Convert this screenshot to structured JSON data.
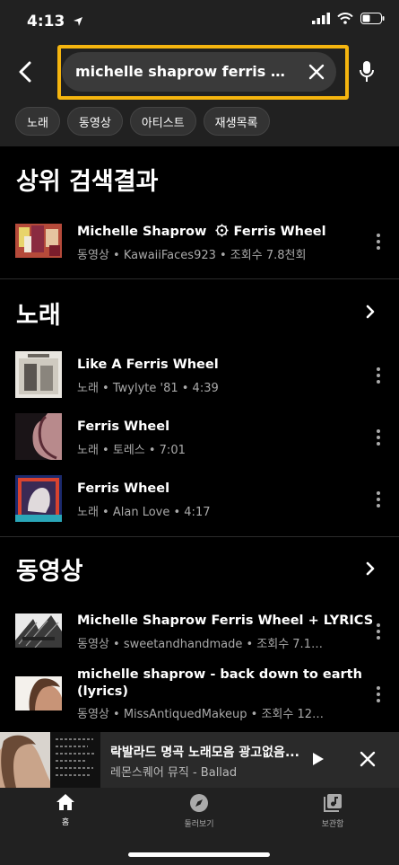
{
  "status": {
    "time": "4:13"
  },
  "search": {
    "query": "michelle shaprow ferris wheel l..."
  },
  "filters": [
    "노래",
    "동영상",
    "아티스트",
    "재생목록"
  ],
  "top_result": {
    "heading": "상위 검색결과",
    "title_part1": "Michelle Shaprow",
    "title_part2": "Ferris Wheel",
    "subtitle": "동영상 • KawaiiFaces923 • 조회수 7.8천회"
  },
  "songs": {
    "heading": "노래",
    "items": [
      {
        "title": "Like A Ferris Wheel",
        "subtitle": "노래 • Twylyte '81 • 4:39"
      },
      {
        "title": "Ferris Wheel",
        "subtitle": "노래 • 토레스 • 7:01"
      },
      {
        "title": "Ferris Wheel",
        "subtitle": "노래 • Alan Love • 4:17"
      }
    ]
  },
  "videos": {
    "heading": "동영상",
    "items": [
      {
        "title": "Michelle Shaprow Ferris Wheel + LYRICS",
        "subtitle": "동영상 • sweetandhandmade • 조회수 7.1…"
      },
      {
        "title_line1": "michelle shaprow - back down to earth",
        "title_line2": "(lyrics)",
        "subtitle": "동영상 • MissAntiquedMakeup • 조회수 12…"
      }
    ]
  },
  "mini_player": {
    "title": "락발라드 명곡 노래모음 광고없음...",
    "artist": "레몬스퀘어 뮤직 - Ballad"
  },
  "nav": {
    "home": "홈",
    "explore": "둘러보기",
    "library": "보관함"
  },
  "colors": {
    "highlight": "#f5b50f",
    "background": "#000000",
    "header": "#212121"
  },
  "icons": [
    "back-icon",
    "clear-icon",
    "mic-icon",
    "chevron-right-icon",
    "more-vert-icon",
    "play-icon",
    "close-icon",
    "home-icon",
    "compass-icon",
    "library-icon"
  ]
}
